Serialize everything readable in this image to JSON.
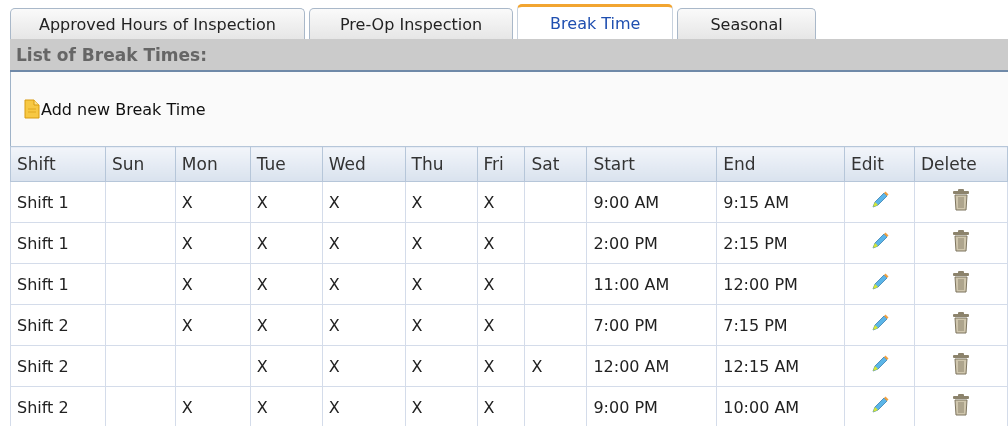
{
  "tabs": [
    {
      "label": "Approved Hours of Inspection",
      "selected": false
    },
    {
      "label": "Pre-Op Inspection",
      "selected": false
    },
    {
      "label": "Break Time",
      "selected": true
    },
    {
      "label": "Seasonal",
      "selected": false
    }
  ],
  "section_title": "List of Break Times:",
  "add_link": "Add new Break Time",
  "table": {
    "columns": [
      "Shift",
      "Sun",
      "Mon",
      "Tue",
      "Wed",
      "Thu",
      "Fri",
      "Sat",
      "Start",
      "End",
      "Edit",
      "Delete"
    ],
    "rows": [
      {
        "shift": "Shift 1",
        "days": {
          "mon": "X",
          "tue": "X",
          "wed": "X",
          "thu": "X",
          "fri": "X"
        },
        "start": "9:00 AM",
        "end": "9:15 AM"
      },
      {
        "shift": "Shift 1",
        "days": {
          "mon": "X",
          "tue": "X",
          "wed": "X",
          "thu": "X",
          "fri": "X"
        },
        "start": "2:00 PM",
        "end": "2:15 PM"
      },
      {
        "shift": "Shift 1",
        "days": {
          "mon": "X",
          "tue": "X",
          "wed": "X",
          "thu": "X",
          "fri": "X"
        },
        "start": "11:00 AM",
        "end": "12:00 PM"
      },
      {
        "shift": "Shift 2",
        "days": {
          "mon": "X",
          "tue": "X",
          "wed": "X",
          "thu": "X",
          "fri": "X"
        },
        "start": "7:00 PM",
        "end": "7:15 PM"
      },
      {
        "shift": "Shift 2",
        "days": {
          "tue": "X",
          "wed": "X",
          "thu": "X",
          "fri": "X",
          "sat": "X"
        },
        "start": "12:00 AM",
        "end": "12:15 AM"
      },
      {
        "shift": "Shift 2",
        "days": {
          "mon": "X",
          "tue": "X",
          "wed": "X",
          "thu": "X",
          "fri": "X"
        },
        "start": "9:00 PM",
        "end": "10:00 AM"
      }
    ]
  }
}
